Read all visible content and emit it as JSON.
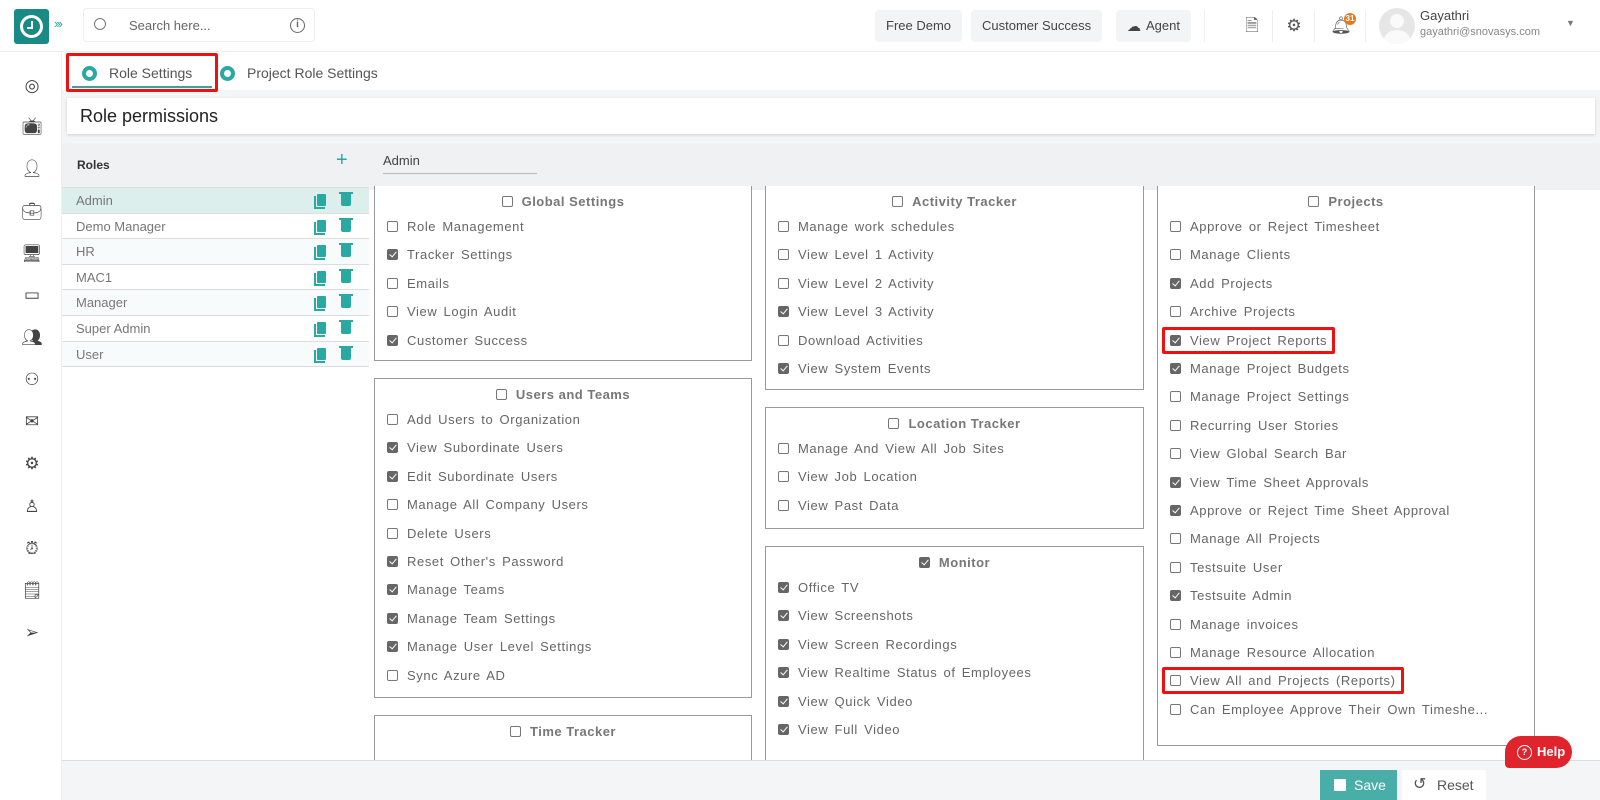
{
  "topbar": {
    "search_placeholder": "Search here...",
    "buttons": [
      "Free Demo",
      "Customer Success",
      "Agent"
    ],
    "notification_count": "31",
    "user": {
      "name": "Gayathri",
      "email": "gayathri@snovasys.com"
    }
  },
  "colors": {
    "brand": "#1a8a86",
    "accent": "#2aa8a2",
    "save": "#4aaea8",
    "help": "#e0242d",
    "highlight": "#ee1111"
  },
  "tabs": [
    {
      "label": "Role Settings",
      "active": true
    },
    {
      "label": "Project Role Settings",
      "active": false
    }
  ],
  "page_title": "Role permissions",
  "roles_panel": {
    "title": "Roles",
    "add_icon": "plus-icon",
    "items": [
      {
        "name": "Admin",
        "selected": true
      },
      {
        "name": "Demo Manager"
      },
      {
        "name": "HR"
      },
      {
        "name": "MAC1"
      },
      {
        "name": "Manager"
      },
      {
        "name": "Super Admin"
      },
      {
        "name": "User"
      }
    ]
  },
  "selected_role": "Admin",
  "sections": {
    "global_settings": {
      "title": "Global Settings",
      "checked": false,
      "items": [
        {
          "label": "Role Management",
          "checked": false
        },
        {
          "label": "Tracker Settings",
          "checked": true
        },
        {
          "label": "Emails",
          "checked": false
        },
        {
          "label": "View Login Audit",
          "checked": false
        },
        {
          "label": "Customer Success",
          "checked": true
        }
      ]
    },
    "users_and_teams": {
      "title": "Users and Teams",
      "checked": false,
      "items": [
        {
          "label": "Add Users to Organization",
          "checked": false
        },
        {
          "label": "View Subordinate Users",
          "checked": true
        },
        {
          "label": "Edit Subordinate Users",
          "checked": true
        },
        {
          "label": "Manage All Company Users",
          "checked": false
        },
        {
          "label": "Delete Users",
          "checked": false
        },
        {
          "label": "Reset Other's Password",
          "checked": true
        },
        {
          "label": "Manage Teams",
          "checked": true
        },
        {
          "label": "Manage Team Settings",
          "checked": true
        },
        {
          "label": "Manage User Level Settings",
          "checked": true
        },
        {
          "label": "Sync Azure AD",
          "checked": false
        }
      ]
    },
    "time_tracker": {
      "title": "Time Tracker",
      "checked": false,
      "items": []
    },
    "activity_tracker": {
      "title": "Activity Tracker",
      "checked": false,
      "items": [
        {
          "label": "Manage work schedules",
          "checked": false
        },
        {
          "label": "View Level 1 Activity",
          "checked": false
        },
        {
          "label": "View Level 2 Activity",
          "checked": false
        },
        {
          "label": "View Level 3 Activity",
          "checked": true
        },
        {
          "label": "Download Activities",
          "checked": false
        },
        {
          "label": "View System Events",
          "checked": true
        }
      ]
    },
    "location_tracker": {
      "title": "Location Tracker",
      "checked": false,
      "items": [
        {
          "label": "Manage And View All Job Sites",
          "checked": false
        },
        {
          "label": "View Job Location",
          "checked": false
        },
        {
          "label": "View Past Data",
          "checked": false
        }
      ]
    },
    "monitor": {
      "title": "Monitor",
      "checked": true,
      "items": [
        {
          "label": "Office TV",
          "checked": true
        },
        {
          "label": "View Screenshots",
          "checked": true
        },
        {
          "label": "View Screen Recordings",
          "checked": true
        },
        {
          "label": "View Realtime Status of Employees",
          "checked": true
        },
        {
          "label": "View Quick Video",
          "checked": true
        },
        {
          "label": "View Full Video",
          "checked": true
        }
      ]
    },
    "projects": {
      "title": "Projects",
      "checked": false,
      "items": [
        {
          "label": "Approve or Reject Timesheet",
          "checked": false
        },
        {
          "label": "Manage Clients",
          "checked": false
        },
        {
          "label": "Add Projects",
          "checked": true
        },
        {
          "label": "Archive Projects",
          "checked": false
        },
        {
          "label": "View Project Reports",
          "checked": true,
          "highlighted": true
        },
        {
          "label": "Manage Project Budgets",
          "checked": true
        },
        {
          "label": "Manage Project Settings",
          "checked": false
        },
        {
          "label": "Recurring User Stories",
          "checked": false
        },
        {
          "label": "View Global Search Bar",
          "checked": false
        },
        {
          "label": "View Time Sheet Approvals",
          "checked": true
        },
        {
          "label": "Approve or Reject Time Sheet Approval",
          "checked": true
        },
        {
          "label": "Manage All Projects",
          "checked": false
        },
        {
          "label": "Testsuite User",
          "checked": false
        },
        {
          "label": "Testsuite Admin",
          "checked": true
        },
        {
          "label": "Manage invoices",
          "checked": false
        },
        {
          "label": "Manage Resource Allocation",
          "checked": false
        },
        {
          "label": "View All and Projects (Reports)",
          "checked": false,
          "highlighted": true
        },
        {
          "label": "Can Employee Approve Their Own Timeshe...",
          "checked": false
        }
      ]
    }
  },
  "footer": {
    "save_label": "Save",
    "reset_label": "Reset",
    "help_label": "Help"
  }
}
